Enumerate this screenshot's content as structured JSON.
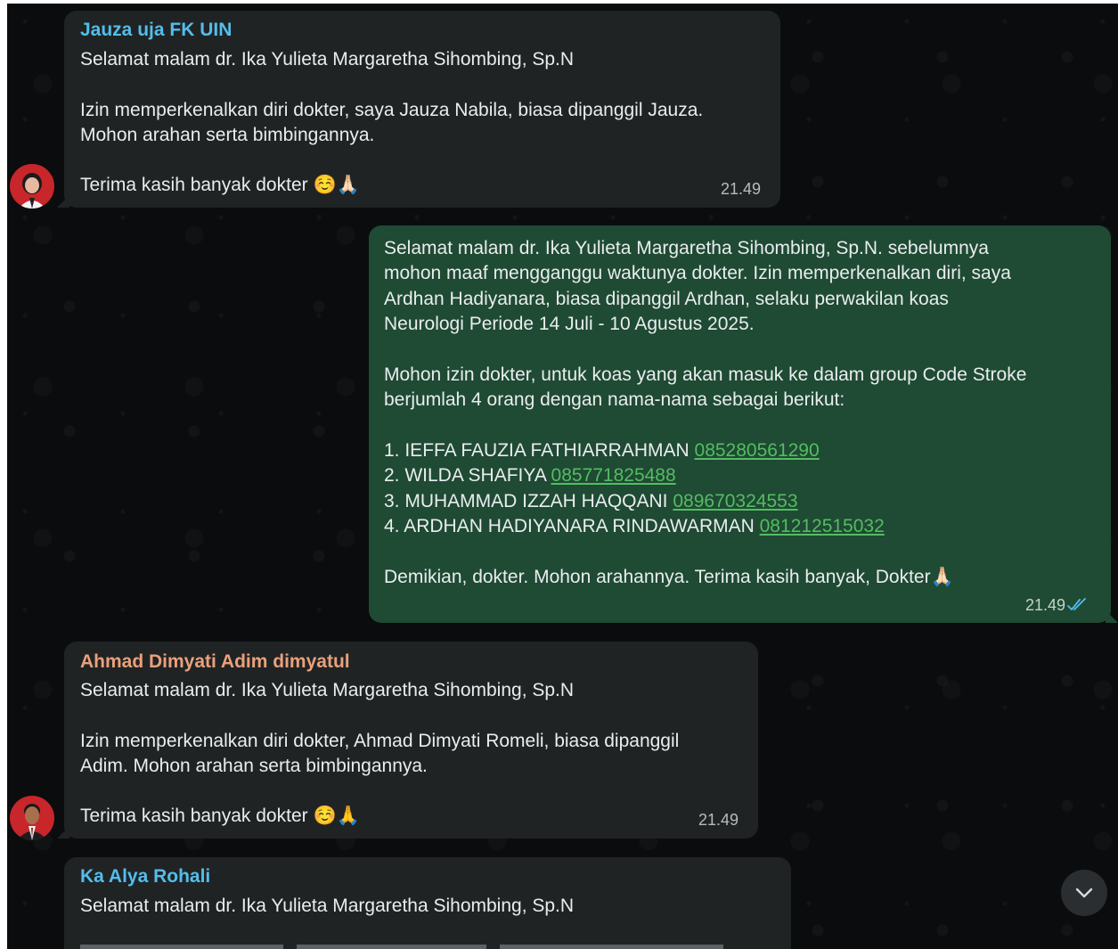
{
  "messages": [
    {
      "sender": "Jauza uja FK UIN",
      "sender_color": "#53bdeb",
      "lines": [
        "Selamat malam dr. Ika Yulieta Margaretha Sihombing, Sp.N",
        "Izin memperkenalkan diri dokter, saya Jauza Nabila, biasa dipanggil Jauza.",
        "Mohon arahan serta bimbingannya.",
        "Terima kasih banyak dokter"
      ],
      "emoji": "☺️🙏🏻",
      "time": "21.49",
      "avatar": "female-avatar-red-background"
    },
    {
      "sender": "",
      "outgoing": true,
      "lines": [
        "Selamat malam dr. Ika Yulieta Margaretha Sihombing, Sp.N. sebelumnya",
        "mohon maaf mengganggu waktunya dokter. Izin memperkenalkan diri, saya",
        "Ardhan Hadiyanara, biasa dipanggil Ardhan, selaku perwakilan koas",
        "Neurologi Periode 14 Juli - 10 Agustus  2025.",
        "Mohon izin dokter, untuk koas yang akan masuk ke dalam group Code Stroke",
        "berjumlah 4 orang dengan nama-nama sebagai berikut:",
        "Demikian, dokter. Mohon arahannya. Terima kasih banyak, Dokter"
      ],
      "list": [
        {
          "name": "1. IEFFA FAUZIA FATHIARRAHMAN ",
          "phone": "085280561290"
        },
        {
          "name": "2. WILDA SHAFIYA ",
          "phone": "085771825488"
        },
        {
          "name": "3. MUHAMMAD IZZAH HAQQANI ",
          "phone": "089670324553"
        },
        {
          "name": "4. ARDHAN HADIYANARA RINDAWARMAN ",
          "phone": "081212515032"
        }
      ],
      "emoji": "🙏🏻",
      "time": "21.49",
      "status": "read-double-check-icon"
    },
    {
      "sender": "Ahmad Dimyati Adim dimyatul",
      "sender_color": "#e9a17b",
      "lines": [
        "Selamat malam dr. Ika Yulieta Margaretha Sihombing, Sp.N",
        "Izin memperkenalkan diri dokter, Ahmad Dimyati Romeli, biasa dipanggil",
        "Adim. Mohon arahan serta bimbingannya.",
        "Terima kasih banyak dokter"
      ],
      "emoji": "☺️🙏",
      "time": "21.49",
      "avatar": "male-avatar-red-background"
    },
    {
      "sender": "Ka Alya Rohali",
      "sender_color": "#53bdeb",
      "lines": [
        "Selamat malam dr. Ika Yulieta Margaretha Sihombing, Sp.N"
      ]
    }
  ],
  "scroll_button_icon": "chevron-down-icon"
}
